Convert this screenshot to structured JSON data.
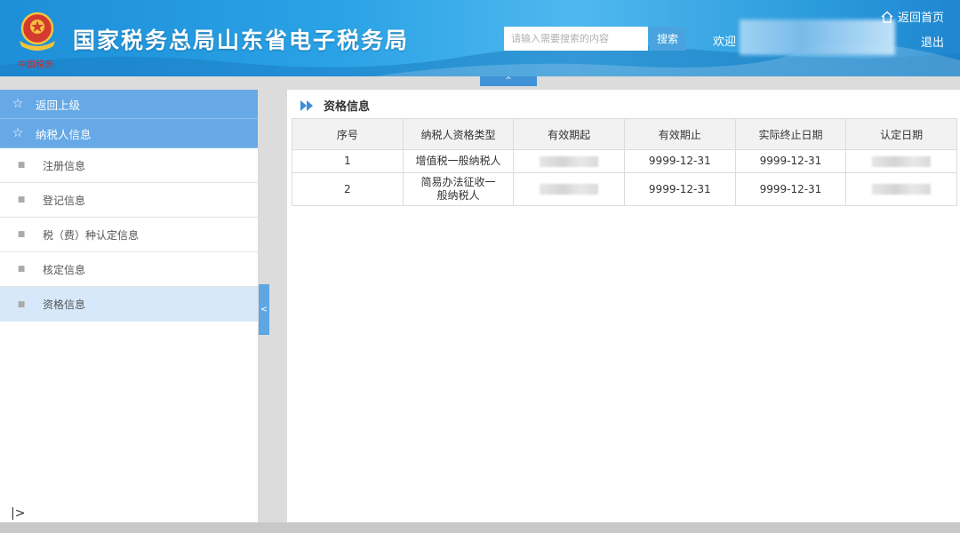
{
  "header": {
    "title": "国家税务总局山东省电子税务局",
    "emblem_caption": "中国税务",
    "search_placeholder": "请输入需要搜索的内容",
    "search_button": "搜索",
    "welcome": "欢迎",
    "home_link": "返回首页",
    "logout": "退出",
    "collapse_glyph": "^"
  },
  "sidebar": {
    "back": "返回上级",
    "section": "纳税人信息",
    "items": [
      {
        "label": "注册信息",
        "active": false
      },
      {
        "label": "登记信息",
        "active": false
      },
      {
        "label": "税（费）种认定信息",
        "active": false
      },
      {
        "label": "核定信息",
        "active": false
      },
      {
        "label": "资格信息",
        "active": true
      }
    ],
    "toggle_glyph": "<",
    "expand_glyph": "|>"
  },
  "main": {
    "title": "资格信息",
    "columns": [
      "序号",
      "纳税人资格类型",
      "有效期起",
      "有效期止",
      "实际终止日期",
      "认定日期"
    ],
    "rows": [
      {
        "index": "1",
        "type": "增值税一般纳税人",
        "valid_to": "9999-12-31",
        "actual_end": "9999-12-31"
      },
      {
        "index": "2",
        "type": "简易办法征收一般纳税人",
        "valid_to": "9999-12-31",
        "actual_end": "9999-12-31"
      }
    ]
  },
  "colors": {
    "header_blue": "#2aa2e6",
    "sidebar_head": "#66a9e6",
    "active_item": "#d6e8f9"
  }
}
